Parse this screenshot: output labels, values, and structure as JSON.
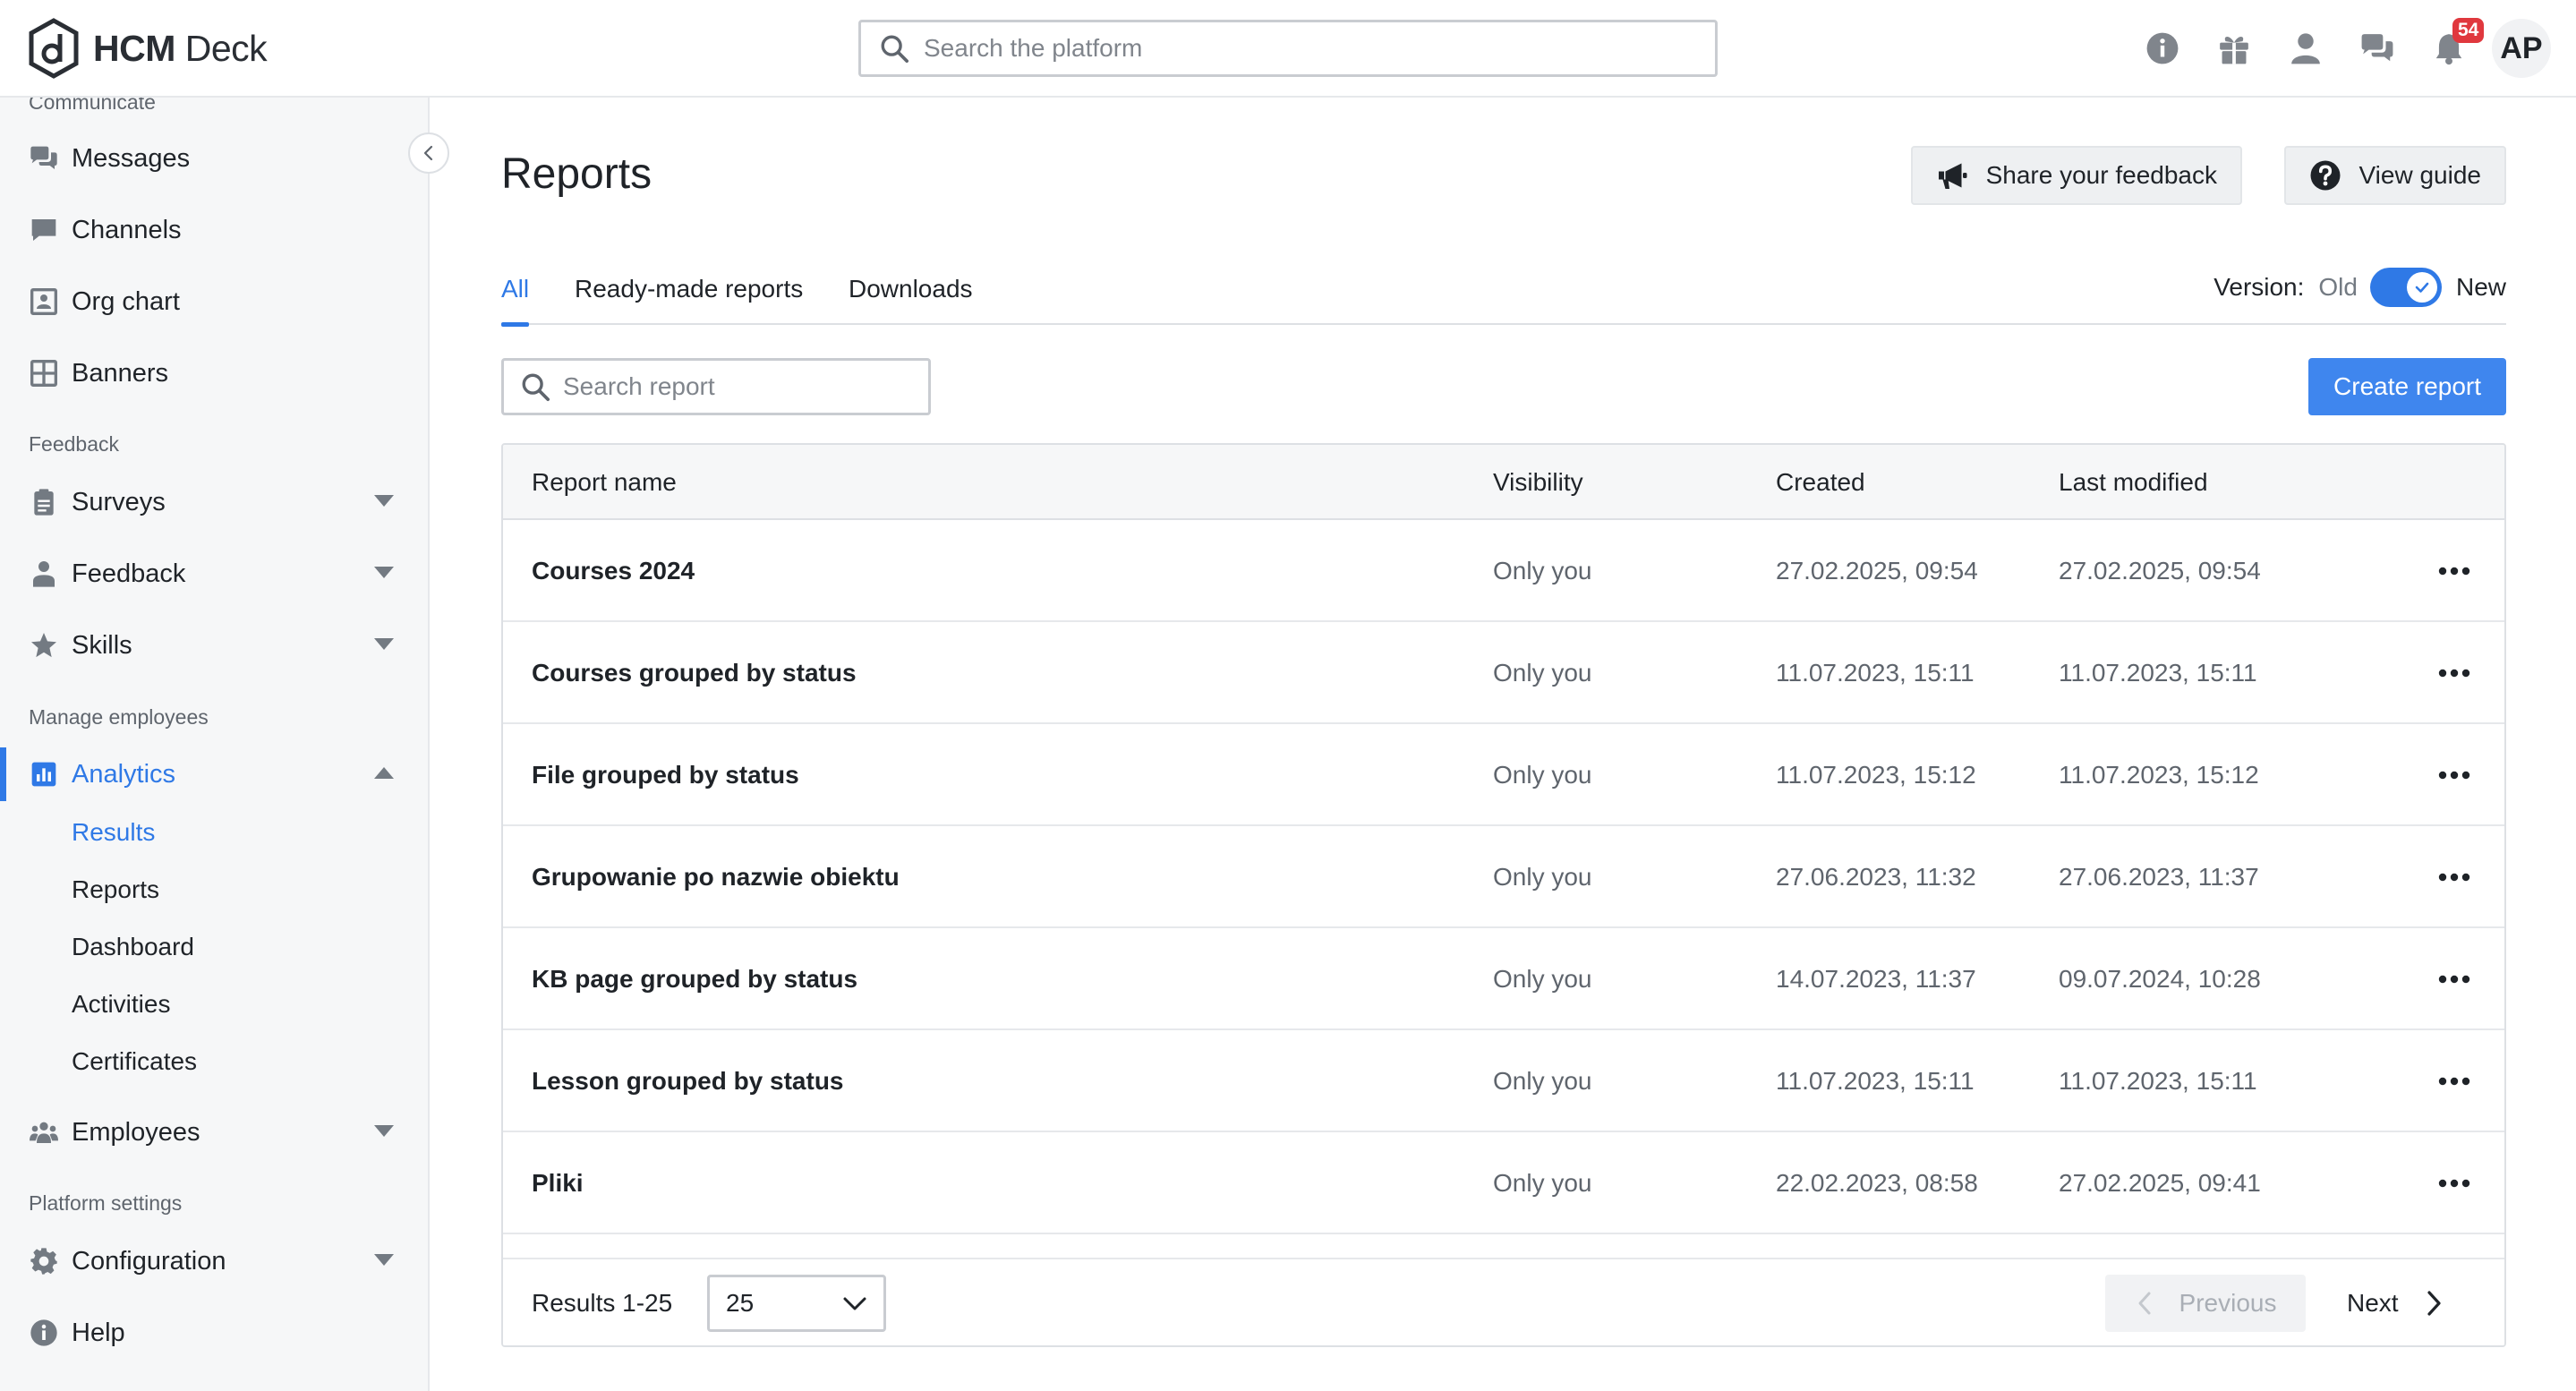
{
  "header": {
    "logo_bold": "HCM",
    "logo_light": " Deck",
    "search_placeholder": "Search the platform",
    "icons": [
      "info-icon",
      "gift-icon",
      "user-icon",
      "chat-icon",
      "bell-icon"
    ],
    "notification_count": "54",
    "avatar_initials": "AP"
  },
  "sidebar": {
    "sections": {
      "communicate": "Communicate",
      "feedback": "Feedback",
      "manage": "Manage employees",
      "platform": "Platform settings"
    },
    "items": {
      "messages": "Messages",
      "channels": "Channels",
      "org_chart": "Org chart",
      "banners": "Banners",
      "surveys": "Surveys",
      "feedback": "Feedback",
      "skills": "Skills",
      "analytics": "Analytics",
      "employees": "Employees",
      "configuration": "Configuration",
      "help": "Help"
    },
    "analytics_sub": {
      "results": "Results",
      "reports": "Reports",
      "dashboard": "Dashboard",
      "activities": "Activities",
      "certificates": "Certificates"
    }
  },
  "main": {
    "title": "Reports",
    "feedback_button": "Share your feedback",
    "guide_button": "View guide",
    "tabs": {
      "all": "All",
      "ready_made": "Ready-made reports",
      "downloads": "Downloads"
    },
    "version": {
      "label": "Version:",
      "old": "Old",
      "new": "New",
      "selected": "New"
    },
    "search_placeholder": "Search report",
    "create_button": "Create report",
    "columns": {
      "name": "Report name",
      "visibility": "Visibility",
      "created": "Created",
      "modified": "Last modified"
    },
    "rows": [
      {
        "name": "Courses 2024",
        "visibility": "Only you",
        "created": "27.02.2025, 09:54",
        "modified": "27.02.2025, 09:54"
      },
      {
        "name": "Courses grouped by status",
        "visibility": "Only you",
        "created": "11.07.2023, 15:11",
        "modified": "11.07.2023, 15:11"
      },
      {
        "name": "File grouped by status",
        "visibility": "Only you",
        "created": "11.07.2023, 15:12",
        "modified": "11.07.2023, 15:12"
      },
      {
        "name": "Grupowanie po nazwie obiektu",
        "visibility": "Only you",
        "created": "27.06.2023, 11:32",
        "modified": "27.06.2023, 11:37"
      },
      {
        "name": "KB page grouped by status",
        "visibility": "Only you",
        "created": "14.07.2023, 11:37",
        "modified": "09.07.2024, 10:28"
      },
      {
        "name": "Lesson grouped by status",
        "visibility": "Only you",
        "created": "11.07.2023, 15:11",
        "modified": "11.07.2023, 15:11"
      },
      {
        "name": "Pliki",
        "visibility": "Only you",
        "created": "22.02.2023, 08:58",
        "modified": "27.02.2025, 09:41"
      }
    ],
    "footer": {
      "results_label": "Results 1-25",
      "page_size": "25",
      "previous": "Previous",
      "next": "Next"
    }
  },
  "colors": {
    "accent": "#2f79e6",
    "create_button": "#3f86ee",
    "badge": "#e0383e"
  }
}
